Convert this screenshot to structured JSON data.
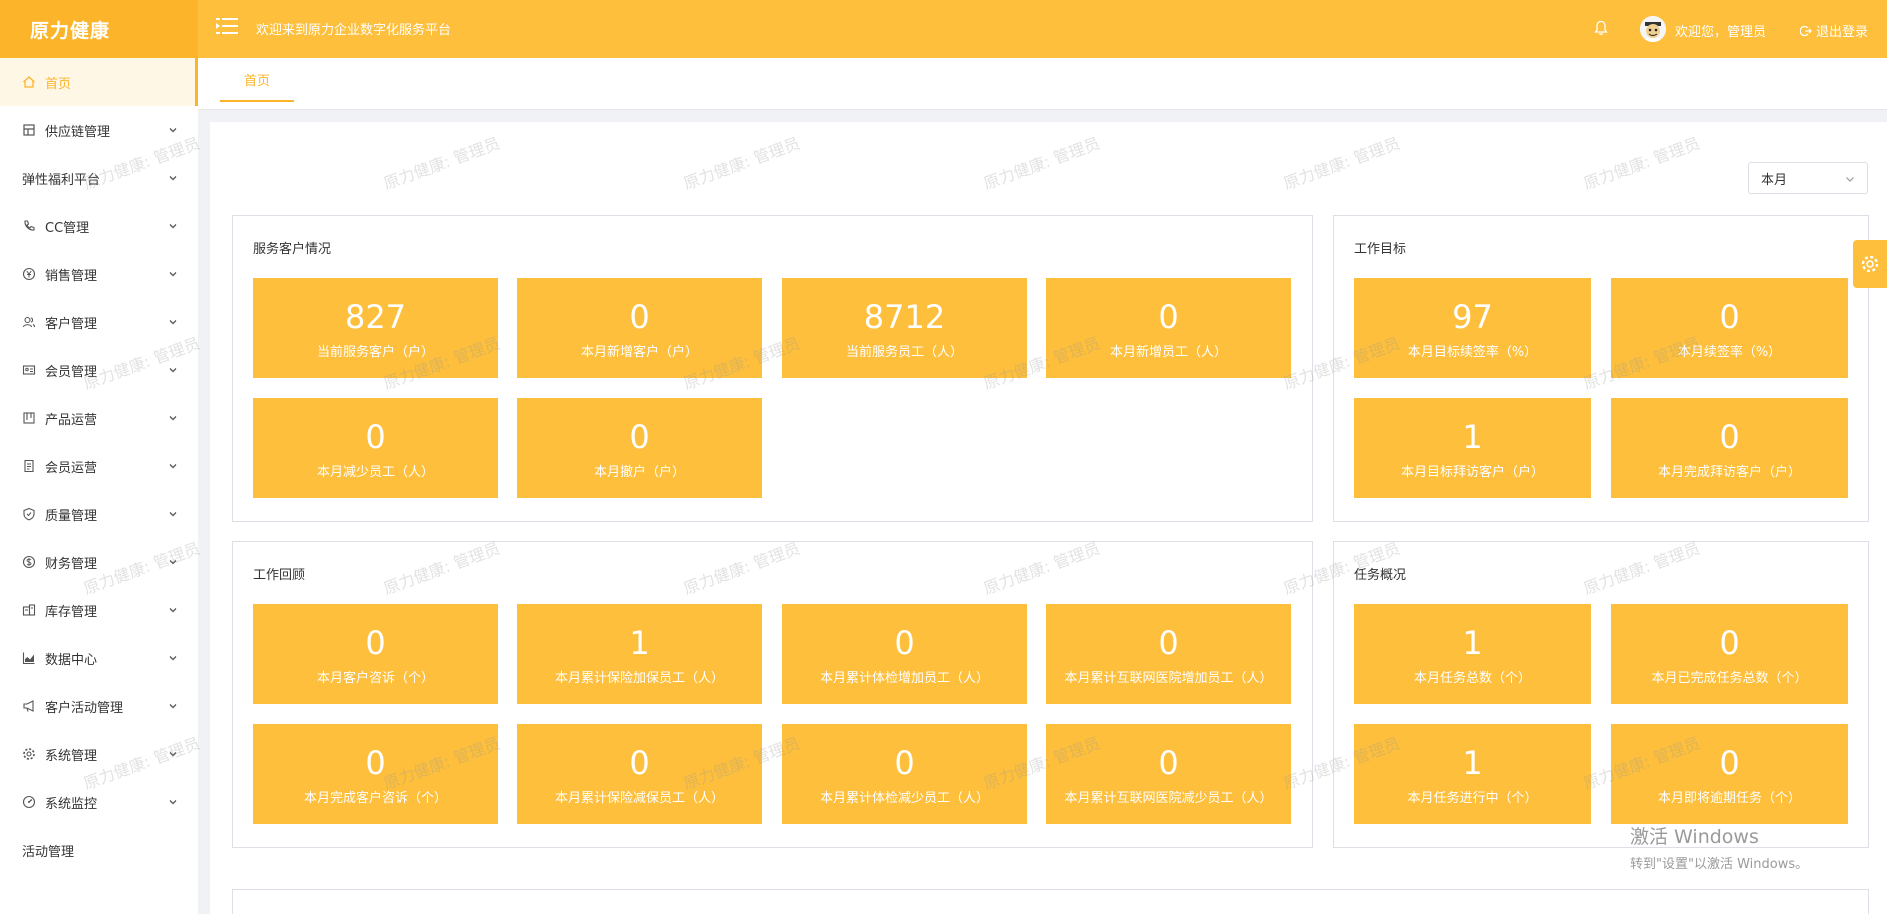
{
  "header": {
    "brand": "原力健康",
    "welcome": "欢迎来到原力企业数字化服务平台",
    "user_greeting": "欢迎您，管理员",
    "logout": "退出登录"
  },
  "sidebar": {
    "items": [
      {
        "label": "首页",
        "icon": "home-icon"
      },
      {
        "label": "供应链管理",
        "icon": "building-icon"
      },
      {
        "label": "弹性福利平台",
        "icon": ""
      },
      {
        "label": "CC管理",
        "icon": "phone-icon"
      },
      {
        "label": "销售管理",
        "icon": "yen-icon"
      },
      {
        "label": "客户管理",
        "icon": "users-icon"
      },
      {
        "label": "会员管理",
        "icon": "id-card-icon"
      },
      {
        "label": "产品运营",
        "icon": "product-icon"
      },
      {
        "label": "会员运营",
        "icon": "document-icon"
      },
      {
        "label": "质量管理",
        "icon": "shield-icon"
      },
      {
        "label": "财务管理",
        "icon": "dollar-icon"
      },
      {
        "label": "库存管理",
        "icon": "warehouse-icon"
      },
      {
        "label": "数据中心",
        "icon": "chart-icon"
      },
      {
        "label": "客户活动管理",
        "icon": "megaphone-icon"
      },
      {
        "label": "系统管理",
        "icon": "gear-icon"
      },
      {
        "label": "系统监控",
        "icon": "dashboard-icon"
      },
      {
        "label": "活动管理",
        "icon": ""
      }
    ]
  },
  "tabs": {
    "home": "首页"
  },
  "filter": {
    "period": "本月"
  },
  "watermark": "原力健康: 管理员",
  "panels": {
    "service_customers": {
      "title": "服务客户情况",
      "stats": [
        {
          "value": "827",
          "label": "当前服务客户（户）"
        },
        {
          "value": "0",
          "label": "本月新增客户（户）"
        },
        {
          "value": "8712",
          "label": "当前服务员工（人）"
        },
        {
          "value": "0",
          "label": "本月新增员工（人）"
        },
        {
          "value": "0",
          "label": "本月减少员工（人）"
        },
        {
          "value": "0",
          "label": "本月撤户（户）"
        }
      ]
    },
    "work_goals": {
      "title": "工作目标",
      "stats": [
        {
          "value": "97",
          "label": "本月目标续签率（%）"
        },
        {
          "value": "0",
          "label": "本月续签率（%）"
        },
        {
          "value": "1",
          "label": "本月目标拜访客户（户）"
        },
        {
          "value": "0",
          "label": "本月完成拜访客户（户）"
        }
      ]
    },
    "work_review": {
      "title": "工作回顾",
      "stats": [
        {
          "value": "0",
          "label": "本月客户咨诉（个）"
        },
        {
          "value": "1",
          "label": "本月累计保险加保员工（人）"
        },
        {
          "value": "0",
          "label": "本月累计体检增加员工（人）"
        },
        {
          "value": "0",
          "label": "本月累计互联网医院增加员工（人）"
        },
        {
          "value": "0",
          "label": "本月完成客户咨诉（个）"
        },
        {
          "value": "0",
          "label": "本月累计保险减保员工（人）"
        },
        {
          "value": "0",
          "label": "本月累计体检减少员工（人）"
        },
        {
          "value": "0",
          "label": "本月累计互联网医院减少员工（人）"
        }
      ]
    },
    "task_overview": {
      "title": "任务概况",
      "stats": [
        {
          "value": "1",
          "label": "本月任务总数（个）"
        },
        {
          "value": "0",
          "label": "本月已完成任务总数（个）"
        },
        {
          "value": "1",
          "label": "本月任务进行中（个）"
        },
        {
          "value": "0",
          "label": "本月即将逾期任务（个）"
        }
      ]
    }
  },
  "os_notice": {
    "line1": "激活 Windows",
    "line2": "转到\"设置\"以激活 Windows。"
  },
  "colors": {
    "accent": "#fdbf3c",
    "brand_bg": "#fcb52a"
  }
}
